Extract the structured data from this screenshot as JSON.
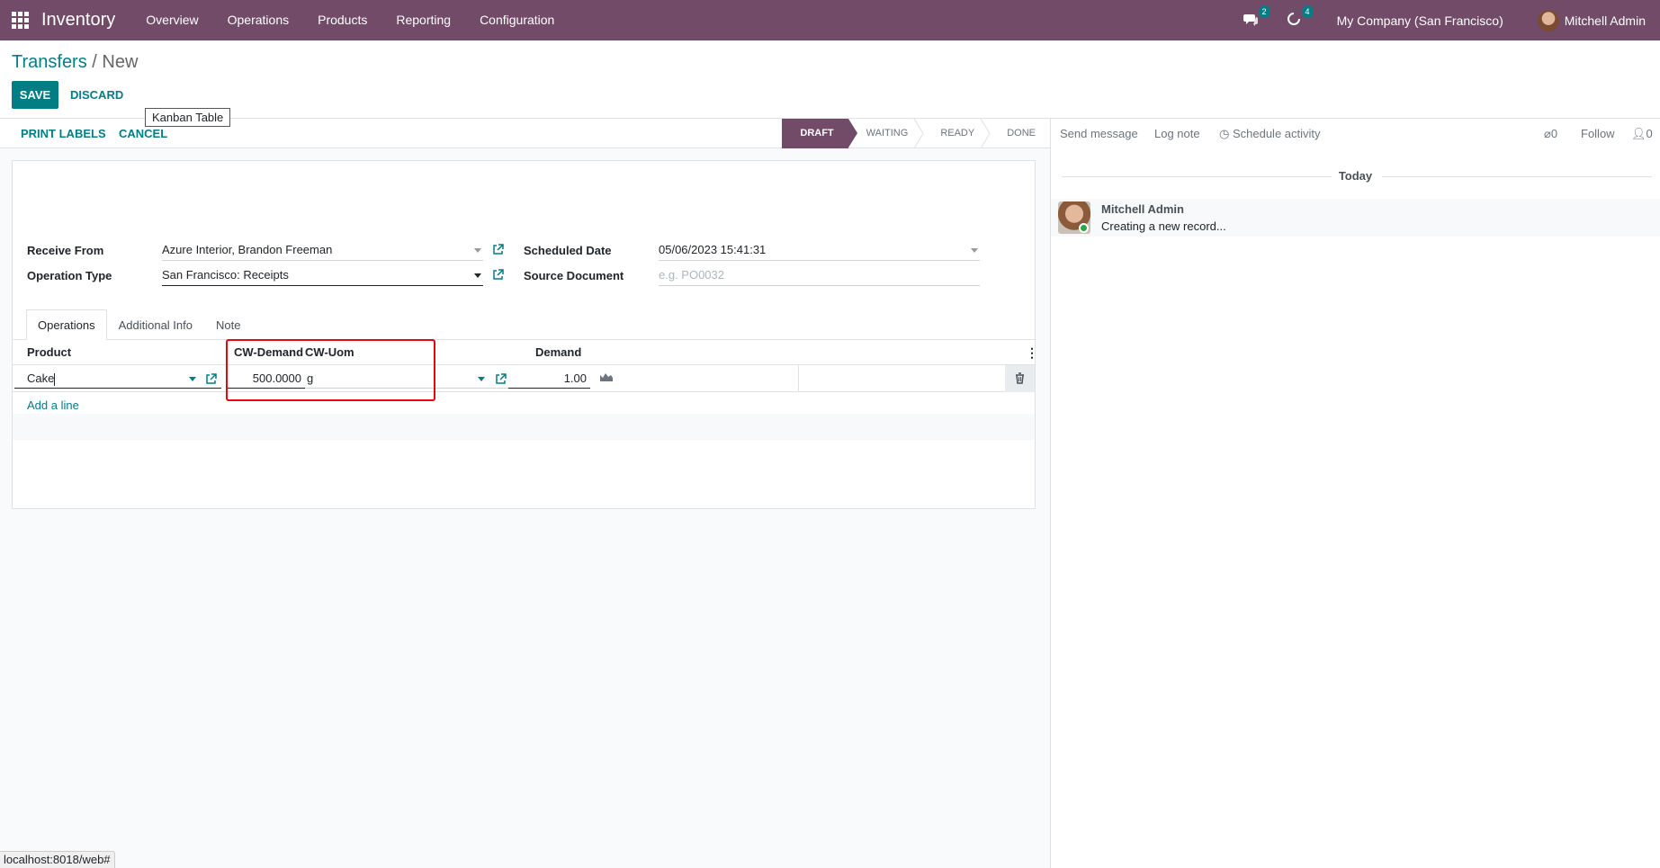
{
  "nav": {
    "app_name": "Inventory",
    "menu": [
      "Overview",
      "Operations",
      "Products",
      "Reporting",
      "Configuration"
    ],
    "messages_count": "2",
    "activities_count": "4",
    "company": "My Company (San Francisco)",
    "user": "Mitchell Admin"
  },
  "breadcrumb": {
    "parent": "Transfers",
    "separator": " / ",
    "current": "New"
  },
  "buttons": {
    "save": "SAVE",
    "discard": "DISCARD"
  },
  "tooltip": "Kanban Table",
  "statusbar": {
    "print_labels": "PRINT LABELS",
    "cancel": "CANCEL",
    "stages": [
      "DRAFT",
      "WAITING",
      "READY",
      "DONE"
    ],
    "active_stage": "DRAFT"
  },
  "form": {
    "receive_from": {
      "label": "Receive From",
      "value": "Azure Interior, Brandon Freeman"
    },
    "operation_type": {
      "label": "Operation Type",
      "value": "San Francisco: Receipts"
    },
    "scheduled_date": {
      "label": "Scheduled Date",
      "value": "05/06/2023 15:41:31"
    },
    "source_document": {
      "label": "Source Document",
      "placeholder": "e.g. PO0032"
    }
  },
  "tabs": [
    "Operations",
    "Additional Info",
    "Note"
  ],
  "table": {
    "headers": {
      "product": "Product",
      "cw_demand": "CW-Demand",
      "cw_uom": "CW-Uom",
      "demand": "Demand"
    },
    "row": {
      "product": "Cake",
      "cw_demand": "500.0000",
      "cw_uom": "g",
      "demand": "1.00"
    },
    "add_line": "Add a line"
  },
  "chatter": {
    "send_message": "Send message",
    "log_note": "Log note",
    "schedule_activity": "Schedule activity",
    "attachments": "0",
    "follow": "Follow",
    "followers": "0",
    "today": "Today",
    "message": {
      "author": "Mitchell Admin",
      "body": "Creating a new record..."
    }
  },
  "status_url": "localhost:8018/web#",
  "colors": {
    "brand": "#714B67",
    "accent": "#017e84",
    "highlight": "#e20a0a"
  }
}
